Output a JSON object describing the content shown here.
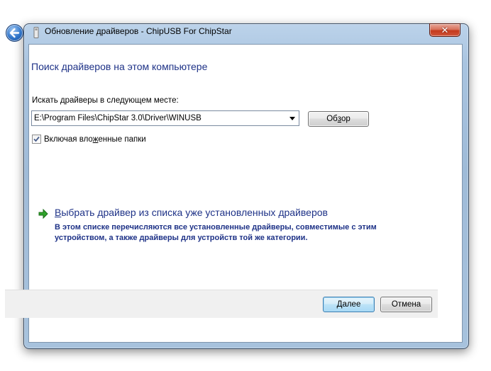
{
  "window": {
    "title": "Обновление драйверов - ChipUSB For ChipStar",
    "close_label": "✕"
  },
  "main": {
    "heading": "Поиск драйверов на этом компьютере",
    "search_label": "Искать драйверы в следующем месте:",
    "path_value": "E:\\Program Files\\ChipStar 3.0\\Driver\\WINUSB",
    "browse": {
      "pre": "Об",
      "accel": "з",
      "post": "ор"
    },
    "include_subfolders": {
      "pre": "Включая вло",
      "accel": "ж",
      "post": "енные папки",
      "checked": true
    }
  },
  "pick_option": {
    "accel": "В",
    "label_rest": "ыбрать драйвер из списка уже установленных драйверов",
    "description": "В этом списке перечисляются все установленные драйверы, совместимые с этим устройством, а также драйверы для устройств той же категории."
  },
  "footer": {
    "next": {
      "accel": "Д",
      "rest": "алее"
    },
    "cancel_label": "Отмена"
  },
  "colors": {
    "link_blue": "#1e3287",
    "arrow_green": "#2fa32b",
    "close_red": "#c4391c"
  },
  "icons": {
    "back": "back-arrow-icon",
    "device": "usb-device-icon",
    "pick": "green-arrow-icon",
    "dropdown": "chevron-down-icon",
    "check": "checkmark-icon"
  }
}
